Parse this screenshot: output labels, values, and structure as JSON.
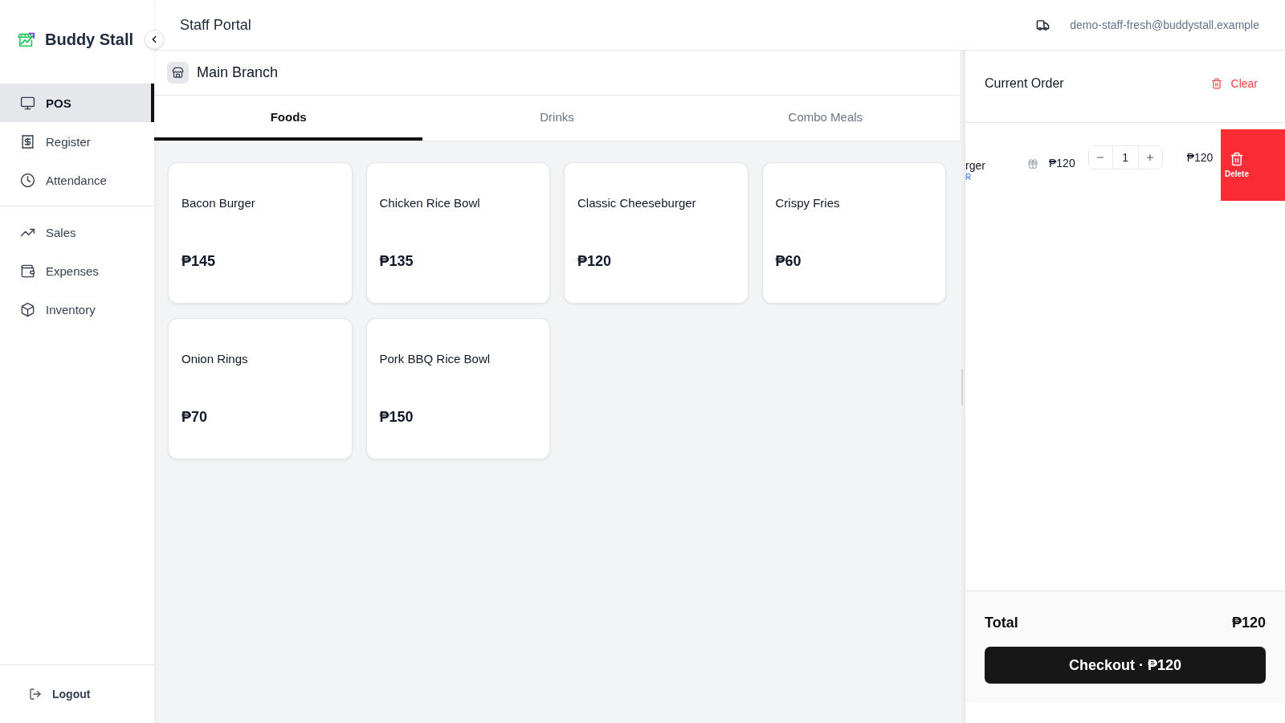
{
  "sidebar": {
    "brand": "Buddy Stall",
    "sections": [
      {
        "items": [
          {
            "label": "POS",
            "selected": true
          },
          {
            "label": "Register",
            "selected": false
          },
          {
            "label": "Attendance",
            "selected": false
          }
        ]
      },
      {
        "items": [
          {
            "label": "Sales",
            "selected": false
          },
          {
            "label": "Expenses",
            "selected": false
          },
          {
            "label": "Inventory",
            "selected": false
          }
        ]
      }
    ],
    "logout": "Logout"
  },
  "header": {
    "title": "Staff Portal",
    "user_email": "demo-staff-fresh@buddystall.example"
  },
  "branch": {
    "name": "Main Branch"
  },
  "tabs": [
    {
      "label": "Foods",
      "selected": true
    },
    {
      "label": "Drinks",
      "selected": false
    },
    {
      "label": "Combo Meals",
      "selected": false
    }
  ],
  "products": [
    {
      "name": "Bacon Burger",
      "price": "₱145"
    },
    {
      "name": "Chicken Rice Bowl",
      "price": "₱135"
    },
    {
      "name": "Classic Cheeseburger",
      "price": "₱120"
    },
    {
      "name": "Crispy Fries",
      "price": "₱60"
    },
    {
      "name": "Onion Rings",
      "price": "₱70"
    },
    {
      "name": "Pork BBQ Rice Bowl",
      "price": "₱150"
    }
  ],
  "order": {
    "title": "Current Order",
    "clear_label": "Clear",
    "items": [
      {
        "name": "rger",
        "note": "R",
        "unit_price": "₱120",
        "quantity": "1",
        "line_total": "₱120",
        "swiped": true,
        "delete_label": "Delete"
      }
    ],
    "total_label": "Total",
    "total": "₱120",
    "checkout_label": "Checkout · ₱120"
  }
}
